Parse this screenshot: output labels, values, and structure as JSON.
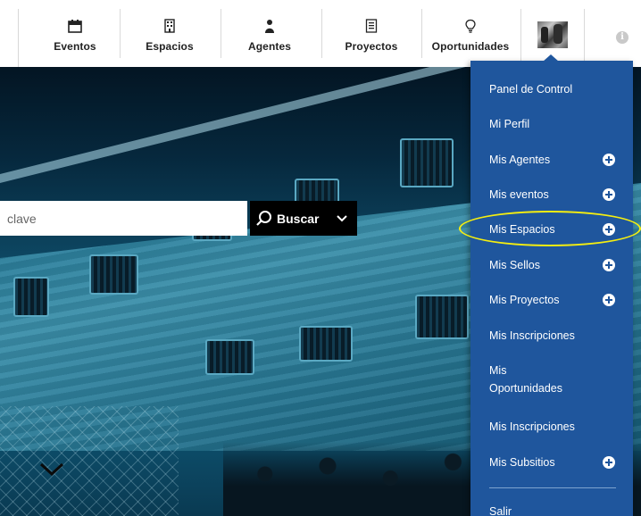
{
  "nav": {
    "items": [
      {
        "label": "Eventos",
        "icon": "calendar-icon"
      },
      {
        "label": "Espacios",
        "icon": "building-icon"
      },
      {
        "label": "Agentes",
        "icon": "person-icon"
      },
      {
        "label": "Proyectos",
        "icon": "document-icon"
      },
      {
        "label": "Oportunidades",
        "icon": "lightbulb-icon"
      }
    ],
    "info_glyph": "i"
  },
  "search": {
    "placeholder": "clave",
    "button_label": "Buscar"
  },
  "user_menu": {
    "items": [
      {
        "label": "Panel de Control",
        "has_add": false
      },
      {
        "label": "Mi Perfil",
        "has_add": false
      },
      {
        "label": "Mis Agentes",
        "has_add": true
      },
      {
        "label": "Mis eventos",
        "has_add": true
      },
      {
        "label": "Mis Espacios",
        "has_add": true
      },
      {
        "label": "Mis Sellos",
        "has_add": true
      },
      {
        "label": "Mis Proyectos",
        "has_add": true
      },
      {
        "label": "Mis Inscripciones",
        "has_add": false
      },
      {
        "label": "Mis Oportunidades",
        "has_add": false
      },
      {
        "label": "Mis Inscripciones",
        "has_add": false
      },
      {
        "label": "Mis Subsitios",
        "has_add": true
      }
    ],
    "logout_label": "Salir",
    "highlighted_item": "Mis Espacios"
  },
  "colors": {
    "menu_bg": "#1f569d",
    "highlight": "#f5ee10",
    "search_button_bg": "#000000"
  }
}
